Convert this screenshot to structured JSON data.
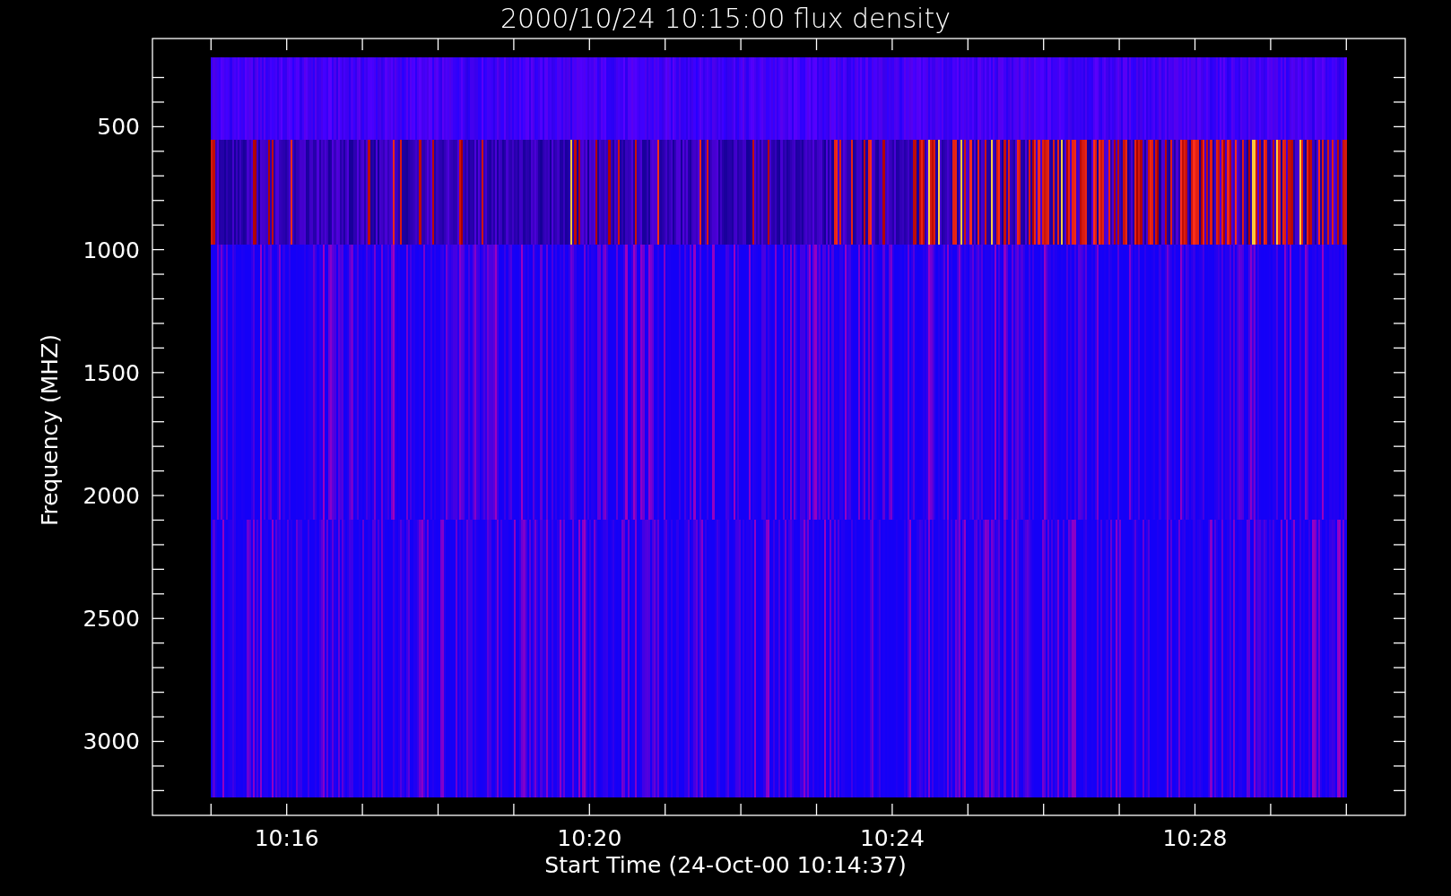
{
  "plot": {
    "title": "2000/10/24 10:15:00 flux density",
    "y_axis": {
      "label": "Frequency (MHZ)",
      "ticks": [
        "500",
        "1000",
        "1500",
        "2000",
        "2500",
        "3000"
      ]
    },
    "x_axis": {
      "label": "Start Time (24-Oct-00 10:14:37)",
      "ticks": [
        "10:16",
        "10:20",
        "10:24",
        "10:28"
      ]
    }
  }
}
